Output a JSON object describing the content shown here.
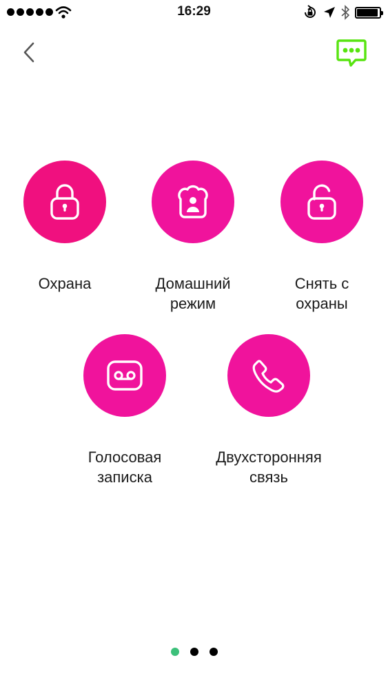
{
  "status_bar": {
    "time": "16:29",
    "icons": [
      "signal-dots-icon",
      "wifi-icon",
      "rotation-lock-icon",
      "location-arrow-icon",
      "bluetooth-icon",
      "battery-icon"
    ]
  },
  "nav": {
    "back_icon": "chevron-left-icon",
    "chat_icon": "chat-bubble-icon",
    "chat_color": "#57e40f"
  },
  "actions": [
    {
      "id": "arm",
      "label": "Охрана",
      "icon": "lock-closed-icon",
      "color": "#f0107f"
    },
    {
      "id": "home",
      "label": "Домашний\nрежим",
      "icon": "home-person-icon",
      "color": "#f0139c"
    },
    {
      "id": "disarm",
      "label": "Снять с\nохраны",
      "icon": "lock-open-icon",
      "color": "#f0139c"
    },
    {
      "id": "voice",
      "label": "Голосовая\nзаписка",
      "icon": "voicemail-icon",
      "color": "#f0139c"
    },
    {
      "id": "call",
      "label": "Двухсторонняя\nсвязь",
      "icon": "phone-icon",
      "color": "#f0139c"
    }
  ],
  "pager": {
    "pages": 3,
    "current": 1,
    "active_color": "#3cc07a",
    "inactive_color": "#000000"
  }
}
